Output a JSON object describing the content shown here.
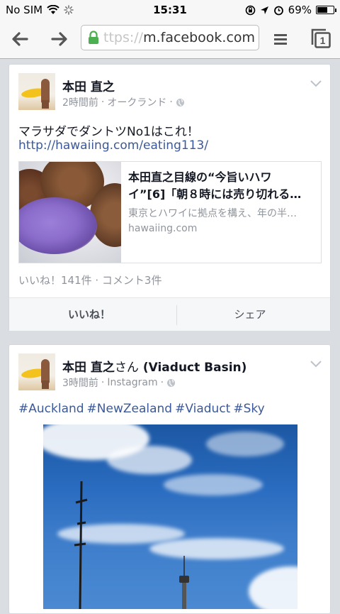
{
  "status_bar": {
    "carrier": "No SIM",
    "time": "15:31",
    "battery_percent": "69%",
    "battery_level": 0.69
  },
  "browser": {
    "url_faded": "ttps://",
    "url_main": "m.facebook.com",
    "tab_count": "1"
  },
  "posts": [
    {
      "author": "本田 直之",
      "timestamp": "2時間前",
      "location": "オークランド",
      "text": "マラサダでダントツNo1はこれ！",
      "link_text": "http://hawaiing.com/eating113/",
      "link_card": {
        "title_line1": "本田直之目線の“今旨いハワ",
        "title_line2": "イ”[6]「朝８時には売り切れる…",
        "description": "東京とハワイに拠点を構え、年の半…",
        "domain": "hawaiing.com"
      },
      "stats": "いいね！141件 · コメント3件",
      "like_label": "いいね！",
      "share_label": "シェア"
    },
    {
      "author": "本田 直之",
      "author_suffix": "さん",
      "place": "(Viaduct Basin)",
      "timestamp": "3時間前",
      "source": "Instagram",
      "hashtags": [
        "#Auckland",
        "#NewZealand",
        "#Viaduct",
        "#Sky"
      ]
    }
  ],
  "colors": {
    "link": "#3b5998",
    "meta": "#90949c",
    "background": "#dadde2"
  }
}
